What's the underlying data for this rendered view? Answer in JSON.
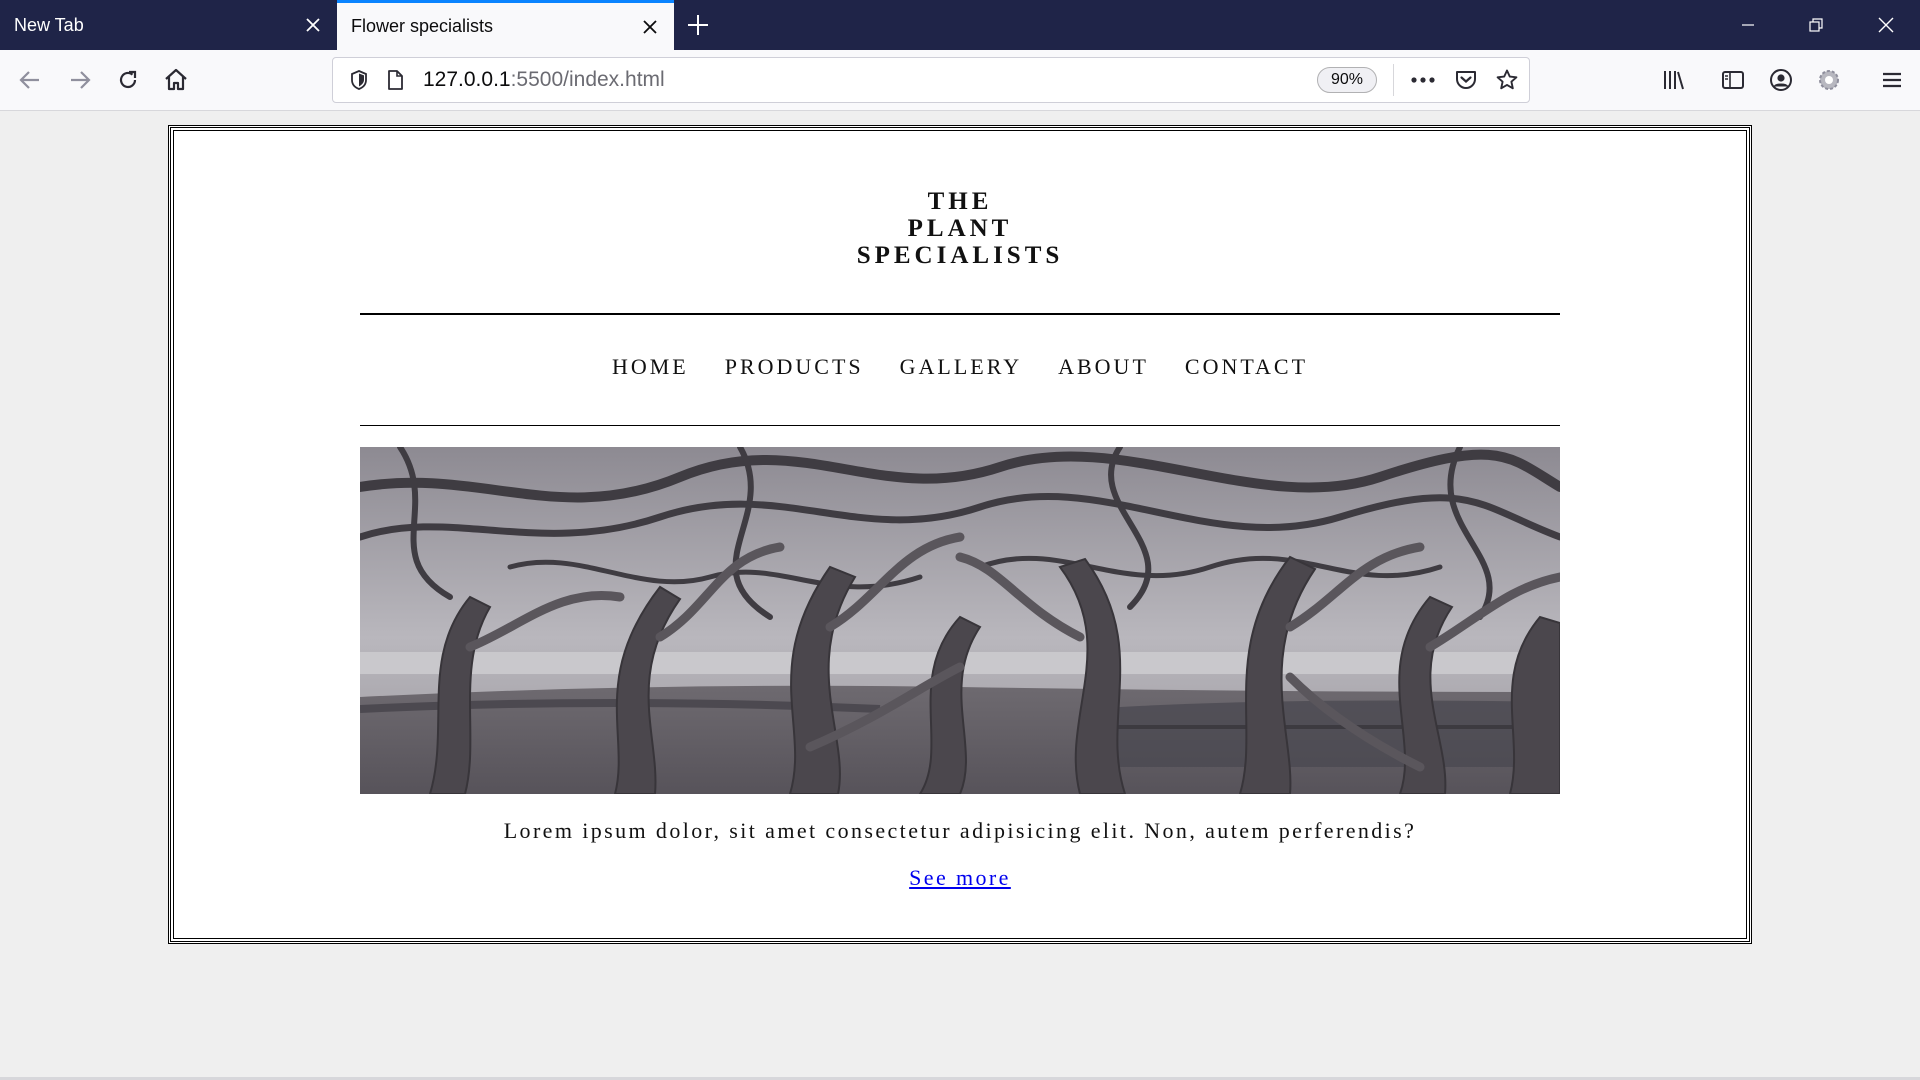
{
  "browser": {
    "tabs": [
      {
        "title": "New Tab",
        "active": false
      },
      {
        "title": "Flower specialists",
        "active": true
      }
    ],
    "url": {
      "host": "127.0.0.1",
      "rest": ":5500/index.html"
    },
    "zoom": "90%",
    "colors": {
      "titlebar": "#1f2448",
      "accent": "#0a84ff",
      "toolbar": "#f9f9fb"
    }
  },
  "page": {
    "logo_lines": [
      "THE",
      "PLANT",
      "SPECIALISTS"
    ],
    "nav": [
      "HOME",
      "PRODUCTS",
      "GALLERY",
      "ABOUT",
      "CONTACT"
    ],
    "hero_icon": "twisted-trees-photo",
    "caption": "Lorem ipsum dolor, sit amet consectetur adipisicing elit. Non, autem perferendis?",
    "link": "See more"
  }
}
